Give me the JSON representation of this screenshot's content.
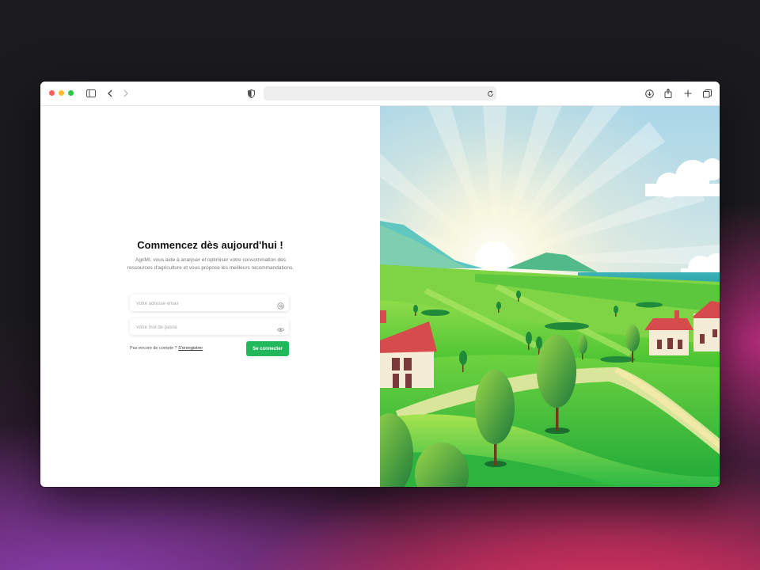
{
  "browser": {
    "address": "",
    "icons": [
      "sidebar-icon",
      "back-icon",
      "forward-icon",
      "shield-icon",
      "reload-icon",
      "download-icon",
      "share-icon",
      "new-tab-icon",
      "tabs-overview-icon"
    ]
  },
  "login": {
    "title": "Commencez dès aujourd'hui !",
    "description": "AgriMI, vous aide à analyser et optimiser votre consommation des ressources d'agriculture et vous propose les meilleurs recommandations.",
    "email_placeholder": "Votre adresse email",
    "password_placeholder": "Votre mot de passe",
    "signup_prompt": "Pas encore de compte ? ",
    "signup_link": "S'enregistrer",
    "submit_label": "Se connecter"
  },
  "colors": {
    "accent": "#21b85c",
    "title": "#111111"
  },
  "illustration": {
    "subject": "farm-landscape-illustration"
  }
}
